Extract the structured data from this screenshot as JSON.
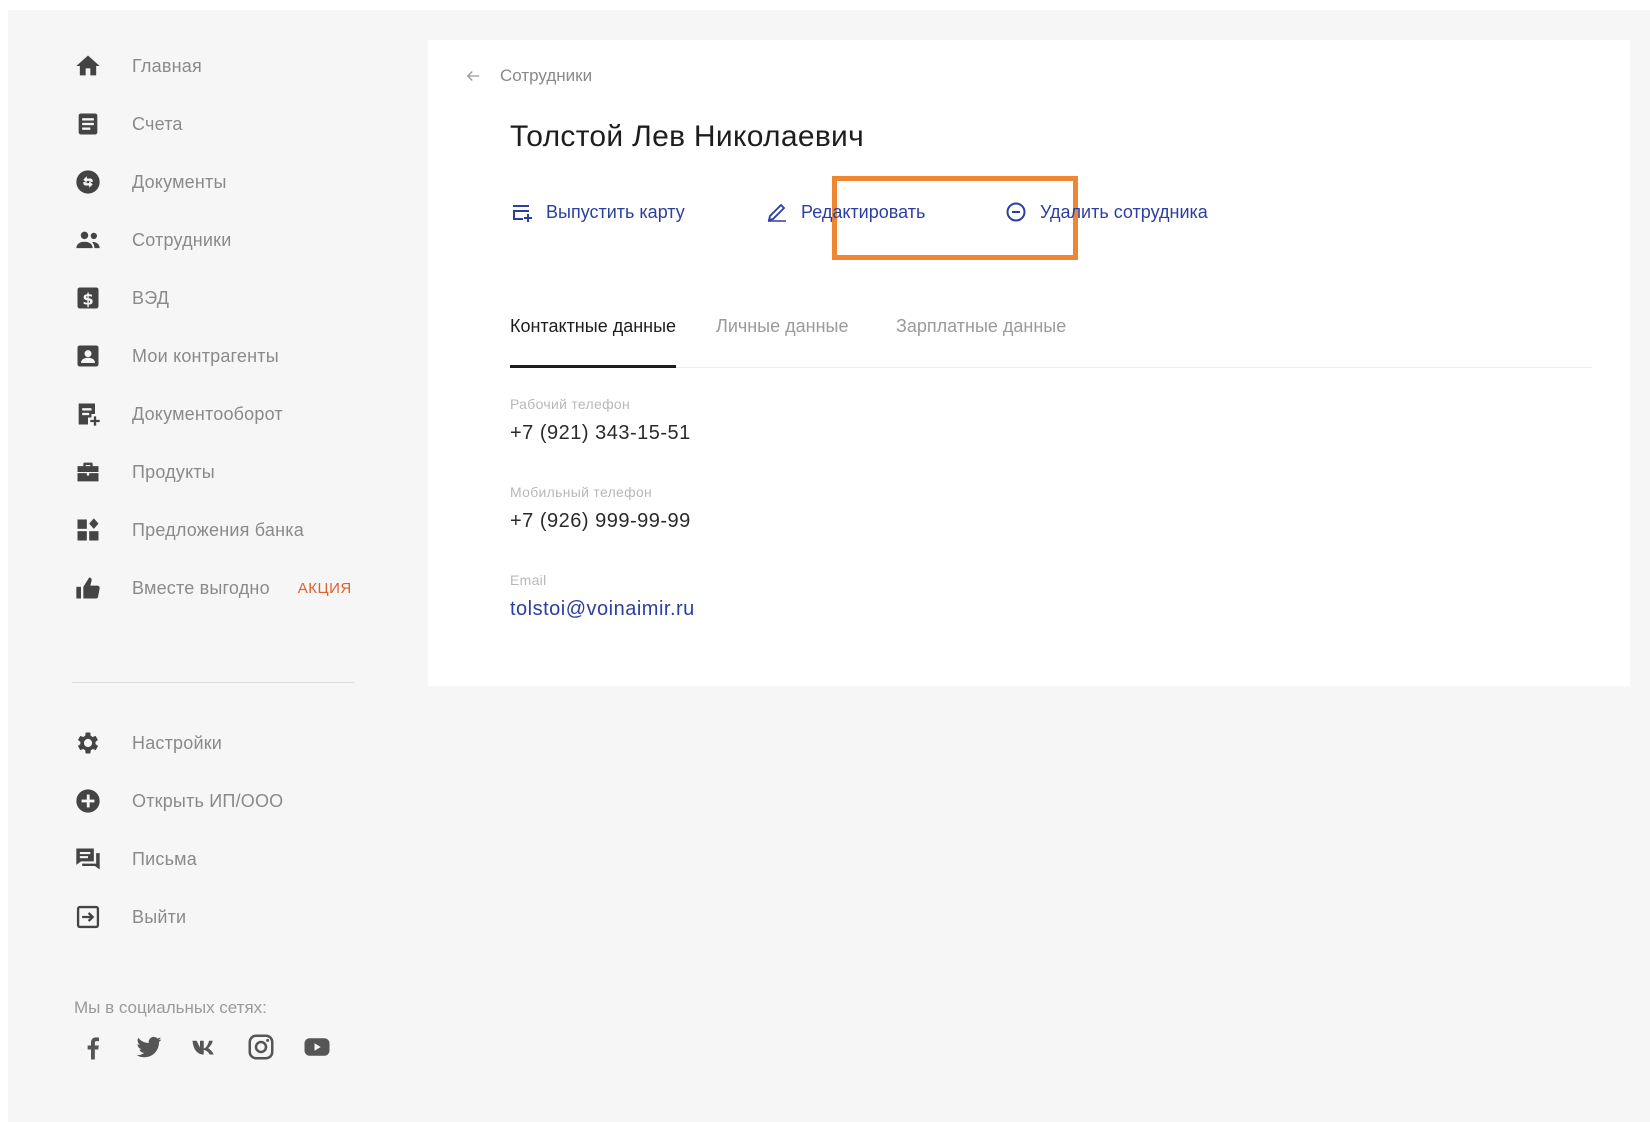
{
  "sidebar": {
    "items": [
      {
        "label": "Главная",
        "icon": "home-icon"
      },
      {
        "label": "Счета",
        "icon": "accounts-icon"
      },
      {
        "label": "Документы",
        "icon": "documents-icon"
      },
      {
        "label": "Сотрудники",
        "icon": "employees-icon"
      },
      {
        "label": "ВЭД",
        "icon": "dollar-icon"
      },
      {
        "label": "Мои контрагенты",
        "icon": "contact-card-icon"
      },
      {
        "label": "Документооборот",
        "icon": "doc-flow-icon"
      },
      {
        "label": "Продукты",
        "icon": "briefcase-icon"
      },
      {
        "label": "Предложения банка",
        "icon": "offers-icon"
      },
      {
        "label": "Вместе выгодно",
        "icon": "thumbs-up-icon",
        "badge": "АКЦИЯ"
      }
    ],
    "bottom_items": [
      {
        "label": "Настройки",
        "icon": "gear-icon"
      },
      {
        "label": "Открыть ИП/ООО",
        "icon": "plus-circle-icon"
      },
      {
        "label": "Письма",
        "icon": "messages-icon"
      },
      {
        "label": "Выйти",
        "icon": "logout-icon"
      }
    ],
    "social_title": "Мы в социальных сетях:",
    "social": [
      "facebook-icon",
      "twitter-icon",
      "vk-icon",
      "instagram-icon",
      "youtube-icon"
    ]
  },
  "main": {
    "breadcrumb": "Сотрудники",
    "title": "Толстой Лев Николаевич",
    "actions": {
      "issue_card": "Выпустить карту",
      "edit": "Редактировать",
      "delete": "Удалить сотрудника"
    },
    "tabs": [
      "Контактные данные",
      "Личные данные",
      "Зарплатные данные"
    ],
    "active_tab": "Контактные данные",
    "fields": [
      {
        "label": "Рабочий телефон",
        "value": "+7 (921) 343-15-51"
      },
      {
        "label": "Мобильный телефон",
        "value": "+7 (926) 999-99-99"
      },
      {
        "label": "Email",
        "value": "tolstoi@voinaimir.ru"
      }
    ]
  },
  "colors": {
    "accent": "#2b3fa0",
    "highlight": "#ee8632",
    "promo": "#e0612a",
    "icon": "#444444"
  }
}
